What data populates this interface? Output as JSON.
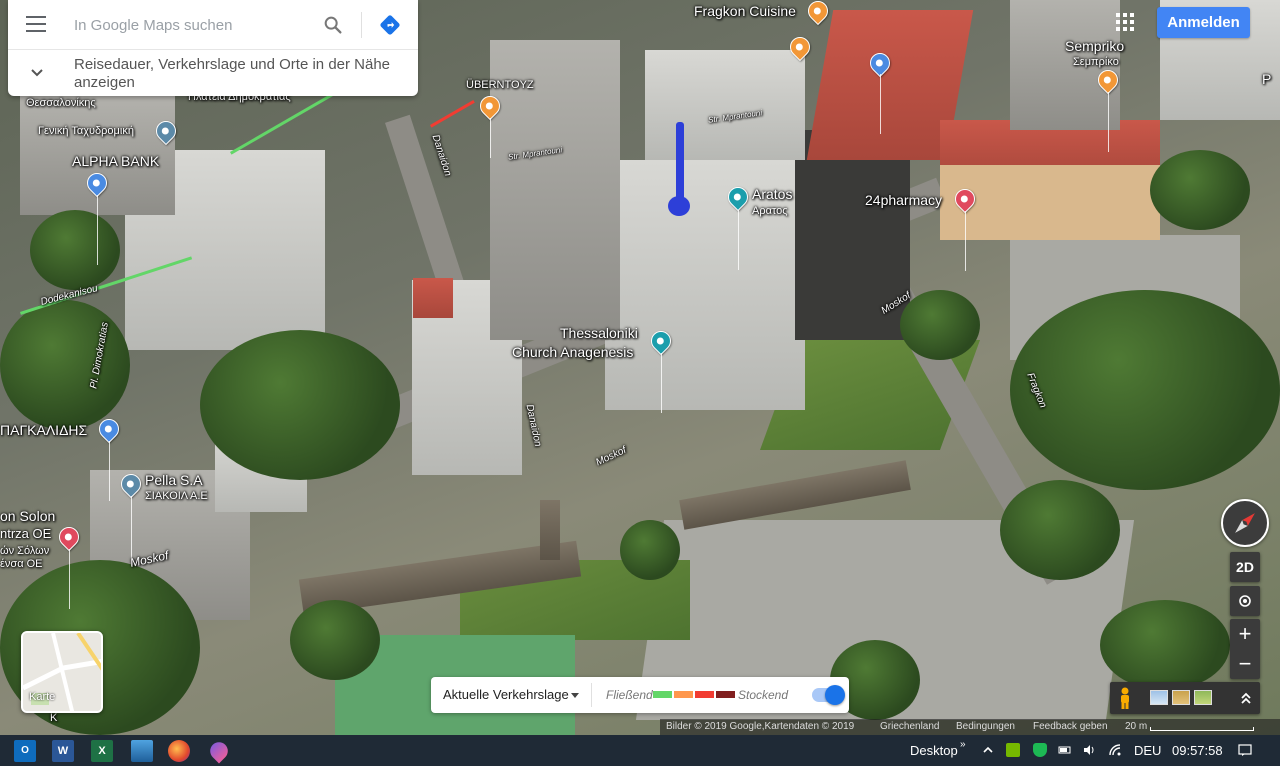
{
  "search": {
    "placeholder": "In Google Maps suchen",
    "nearby_text": "Reisedauer, Verkehrslage und Orte in der Nähe anzeigen"
  },
  "header": {
    "signin_label": "Anmelden"
  },
  "map": {
    "labels": {
      "fragkon_cuisine": "Fragkon Cuisine",
      "semprikо": "Sempriko",
      "sempriko_gr": "Σεμπρίκο",
      "ubern_toyz": "ÜBERNTOYZ",
      "aratos": "Aratos",
      "aratos_gr": "Αρατος",
      "pharmacy": "24pharmacy",
      "alpha_bank": "ALPHA BANK",
      "geniki": "Γενική Ταχυδρομική",
      "thessalonikis": "Θεσσαλονίκης",
      "platia": "Πλατεία Δημοκρατίας",
      "church_1": "Thessaloniki",
      "church_2": "Church Anagenesis",
      "pagkalidis": "ΠΑΓΚΑΛΙΔΗΣ",
      "pella_1": "Pella S.A",
      "pella_2": "ΣΙΑΚΟΙΛ Α.Ε",
      "solon_1": "on Solon",
      "solon_2": "ntrza OE",
      "solon_3": "ών Σόλων",
      "solon_4": "ένσα ΟΕ",
      "street_moskof1": "Moskof",
      "street_moskof2": "Moskof",
      "street_moskof3": "Moskof",
      "street_danaidon1": "Danaidon",
      "street_danaidon2": "Danaidon",
      "street_dodekanisou": "Dodekanisou",
      "street_dimokratias": "Pl. Dimokratias",
      "street_fragkon": "Fragkon",
      "street_mprantouni": "Str. Mprantouni",
      "street_mprantouni2": "Str. Mprantouni",
      "edge_p": "P",
      "edge_k": "K"
    }
  },
  "controls": {
    "view_2d": "2D",
    "zoom_in": "+",
    "zoom_out": "−",
    "minimap_label": "Karte"
  },
  "traffic": {
    "select_label": "Aktuelle Verkehrslage",
    "fast_label": "Fließend",
    "slow_label": "Stockend",
    "colors": [
      "#63d668",
      "#ff974d",
      "#f23c32",
      "#811f1f"
    ],
    "toggle_on": true
  },
  "footer": {
    "imagery": "Bilder © 2019 Google,Kartendaten © 2019",
    "country": "Griechenland",
    "terms": "Bedingungen",
    "feedback": "Feedback geben",
    "scale": "20 m"
  },
  "taskbar": {
    "desktop_label": "Desktop",
    "language": "DEU",
    "time": "09:57:58"
  }
}
